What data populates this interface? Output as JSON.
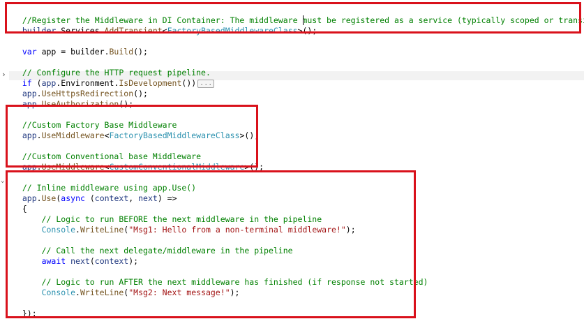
{
  "code": {
    "l1": {
      "comment": "//Register the Middleware in DI Container: The middleware must be registered as a service (typically scoped or transient)"
    },
    "l2": {
      "a": "builder",
      "b": ".Services.",
      "c": "AddTransient",
      "d": "<",
      "e": "FactoryBasedMiddlewareClass",
      "f": ">();"
    },
    "l3": {
      "kw": "var",
      "a": " app = builder.",
      "m": "Build",
      "b": "();"
    },
    "l4": {
      "comment": "// Configure the HTTP request pipeline."
    },
    "l5": {
      "kw": "if",
      "a": " (",
      "b": "app",
      "c": ".Environment.",
      "m": "IsDevelopment",
      "d": "())",
      "ellipsis": "..."
    },
    "l6": {
      "a": "app",
      "b": ".",
      "m": "UseHttpsRedirection",
      "c": "();"
    },
    "l7": {
      "a": "app",
      "b": ".",
      "m": "UseAuthorization",
      "c": "();"
    },
    "l8": {
      "comment": "//Custom Factory Base Middleware"
    },
    "l9": {
      "a": "app",
      "b": ".",
      "m": "UseMiddleware",
      "c": "<",
      "t": "FactoryBasedMiddlewareClass",
      "d": ">();"
    },
    "l10": {
      "comment": "//Custom Conventional base Middleware"
    },
    "l11": {
      "a": "app",
      "b": ".",
      "m": "UseMiddleware",
      "c": "<",
      "t": "CustomConventionalMiddleware",
      "d": ">();"
    },
    "l12": {
      "comment": "// Inline middleware using app.Use()"
    },
    "l13": {
      "a": "app",
      "b": ".",
      "m": "Use",
      "c": "(",
      "kw": "async",
      "d": " (",
      "p1": "context",
      "e": ", ",
      "p2": "next",
      "f": ") =>"
    },
    "l14": {
      "a": "{"
    },
    "l15": {
      "comment": "    // Logic to run BEFORE the next middleware in the pipeline"
    },
    "l16": {
      "indent": "    ",
      "t": "Console",
      "b": ".",
      "m": "WriteLine",
      "c": "(",
      "s": "\"Msg1: Hello from a non-terminal middleware!\"",
      "d": ");"
    },
    "l17": {
      "comment": "    // Call the next delegate/middleware in the pipeline"
    },
    "l18": {
      "indent": "    ",
      "kw": "await",
      "sp": " ",
      "p": "next",
      "c": "(",
      "p2": "context",
      "d": ");"
    },
    "l19": {
      "comment": "    // Logic to run AFTER the next middleware has finished (if response not started)"
    },
    "l20": {
      "indent": "    ",
      "t": "Console",
      "b": ".",
      "m": "WriteLine",
      "c": "(",
      "s": "\"Msg2: Next message!\"",
      "d": ");"
    },
    "l21": {
      "a": "});"
    }
  },
  "colors": {
    "highlight_box": "#d9111b",
    "comment": "#008000",
    "keyword": "#0000ff",
    "type": "#2b91af",
    "string": "#a31515"
  },
  "icons": {
    "collapse": "chevron-right-icon",
    "fold": "chevron-down-icon"
  }
}
